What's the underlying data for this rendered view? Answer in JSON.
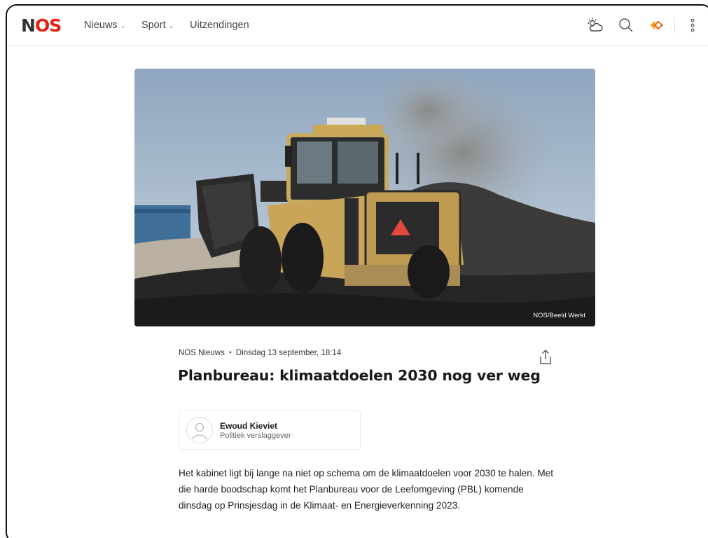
{
  "brand": {
    "logo_text_a": "N",
    "logo_text_b": "OS",
    "accent": "#e61e14"
  },
  "nav": {
    "items": [
      {
        "label": "Nieuws",
        "dropdown": true
      },
      {
        "label": "Sport",
        "dropdown": true
      },
      {
        "label": "Uitzendingen",
        "dropdown": false
      }
    ]
  },
  "tools": {
    "icons": [
      "weather-icon",
      "search-icon",
      "npo-icon",
      "more-icon"
    ]
  },
  "hero": {
    "credit": "NOS/Beeld Werkt"
  },
  "article": {
    "source": "NOS Nieuws",
    "separator": "•",
    "date": "Dinsdag 13 september, 18:14",
    "headline": "Planbureau: klimaatdoelen 2030 nog ver weg",
    "author": {
      "name": "Ewoud Kieviet",
      "role": "Politiek verslaggever"
    },
    "lead": "Het kabinet ligt bij lange na niet op schema om de klimaatdoelen voor 2030 te halen. Met die harde boodschap komt het Planbureau voor de Leefomgeving (PBL) komende dinsdag op Prinsjesdag in de Klimaat- en Energieverkenning 2023."
  }
}
